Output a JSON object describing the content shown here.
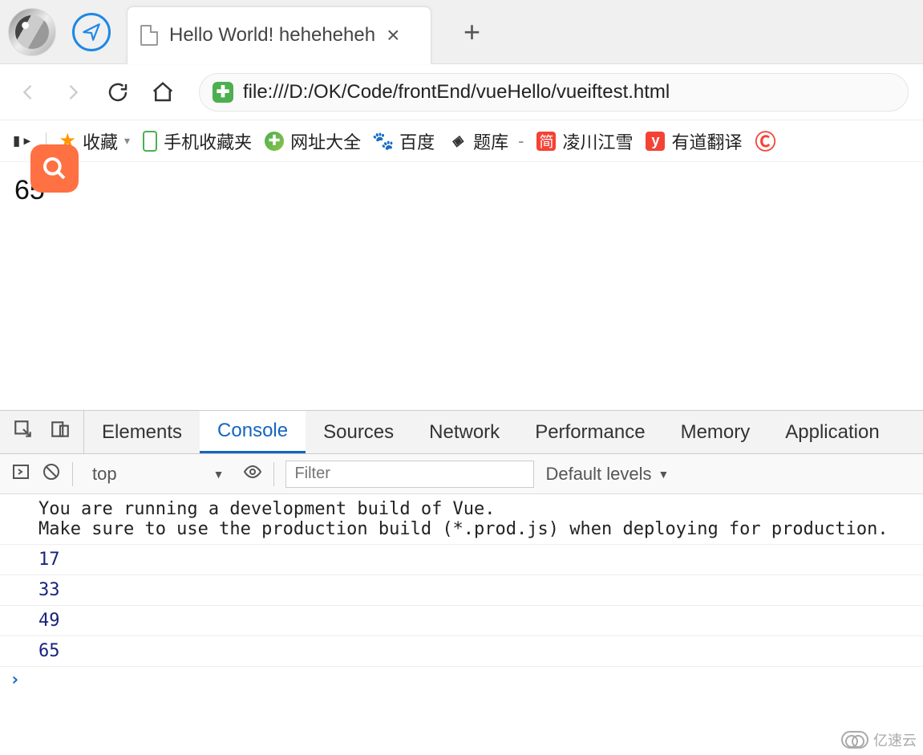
{
  "tab": {
    "title": "Hello World! heheheheh"
  },
  "url": "file:///D:/OK/Code/frontEnd/vueHello/vueiftest.html",
  "bookmarks": {
    "favorites_label": "收藏",
    "items": [
      {
        "label": "手机收藏夹"
      },
      {
        "label": "网址大全"
      },
      {
        "label": "百度"
      },
      {
        "label": "题库"
      },
      {
        "label": "凌川江雪"
      },
      {
        "label": "有道翻译"
      }
    ]
  },
  "page": {
    "value": "65"
  },
  "devtools": {
    "tabs": [
      "Elements",
      "Console",
      "Sources",
      "Network",
      "Performance",
      "Memory",
      "Application"
    ],
    "active_tab": "Console",
    "scope": "top",
    "filter_placeholder": "Filter",
    "levels_label": "Default levels",
    "console": {
      "warning": "You are running a development build of Vue.\nMake sure to use the production build (*.prod.js) when deploying for production.",
      "logs": [
        "17",
        "33",
        "49",
        "65"
      ]
    }
  },
  "watermark": "亿速云"
}
